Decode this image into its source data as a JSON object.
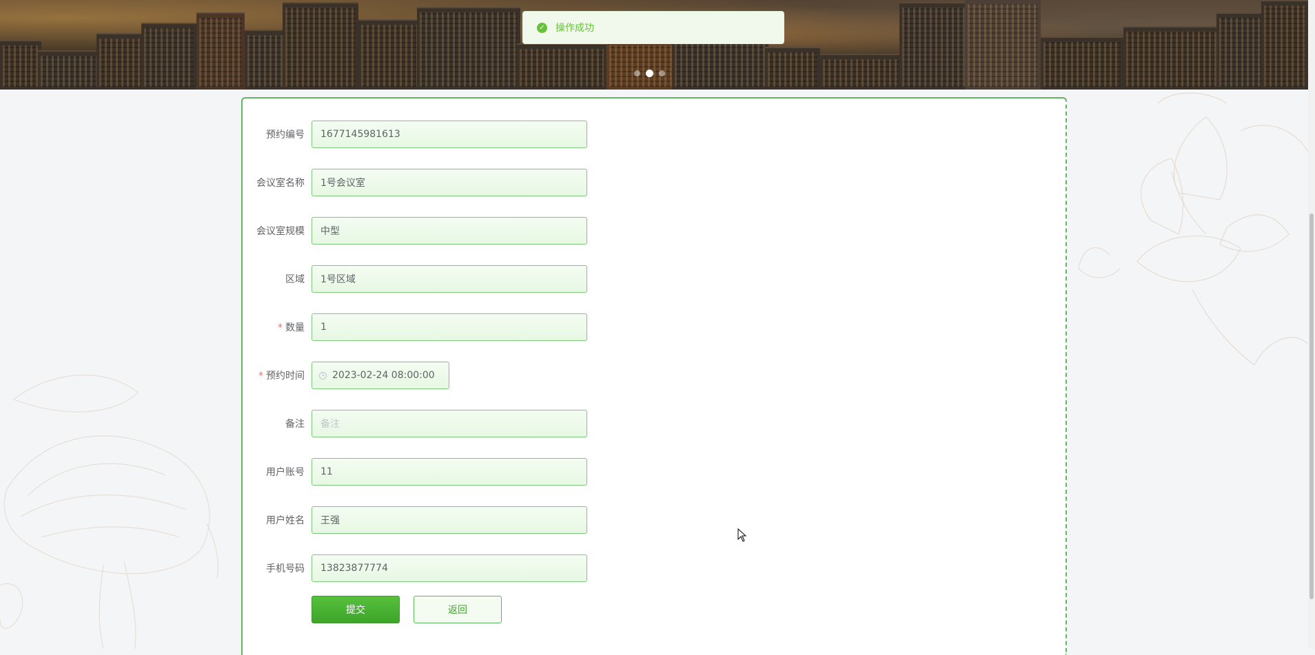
{
  "toast": {
    "message": "操作成功",
    "type": "success"
  },
  "banner": {
    "slides": 3,
    "active_slide": 2
  },
  "form": {
    "fields": [
      {
        "label": "预约编号",
        "value": "1677145981613",
        "required": false
      },
      {
        "label": "会议室名称",
        "value": "1号会议室",
        "required": false
      },
      {
        "label": "会议室规模",
        "value": "中型",
        "required": false
      },
      {
        "label": "区域",
        "value": "1号区域",
        "required": false
      },
      {
        "label": "数量",
        "value": "1",
        "required": true
      },
      {
        "label": "预约时间",
        "value": "2023-02-24 08:00:00",
        "required": true,
        "icon": "clock-icon"
      },
      {
        "label": "备注",
        "value": "",
        "placeholder": "备注",
        "required": false
      },
      {
        "label": "用户账号",
        "value": "11",
        "required": false
      },
      {
        "label": "用户姓名",
        "value": "王强",
        "required": false
      },
      {
        "label": "手机号码",
        "value": "13823877774",
        "required": false
      }
    ],
    "submit_label": "提交",
    "back_label": "返回"
  },
  "colors": {
    "accent": "#5cb85c",
    "success": "#67c23a",
    "required": "#f56c6c"
  }
}
